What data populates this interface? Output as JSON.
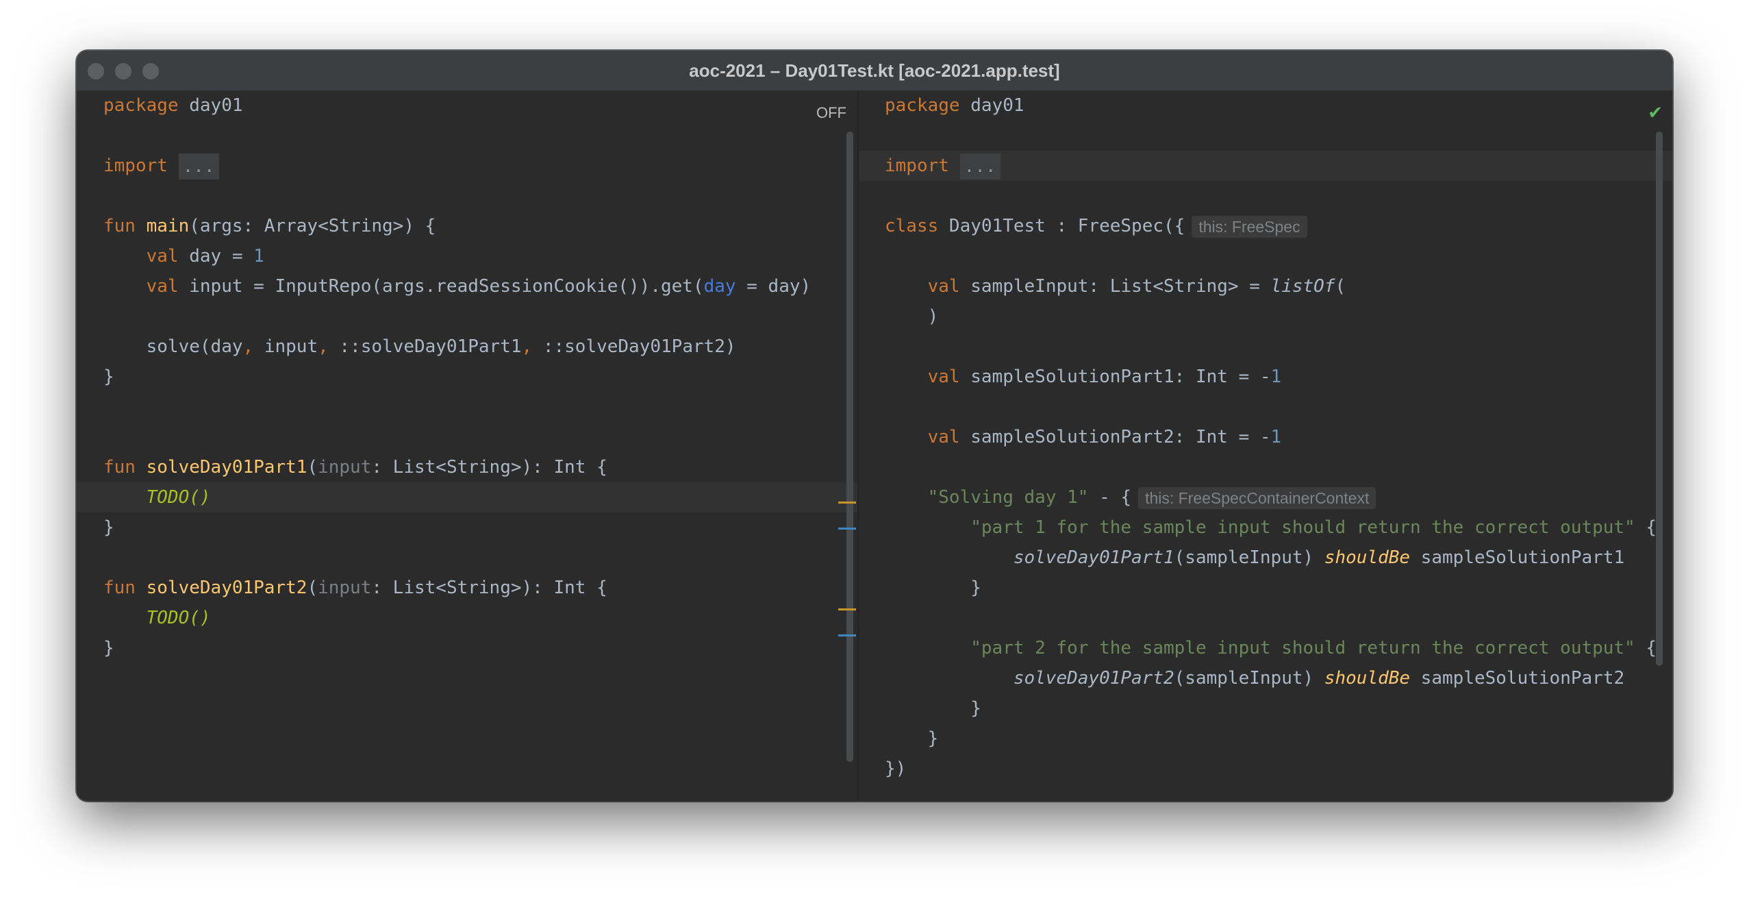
{
  "window": {
    "title": "aoc-2021 – Day01Test.kt [aoc-2021.app.test]"
  },
  "left_pane": {
    "status_label": "OFF",
    "lines": {
      "l1": [
        "package",
        " day01"
      ],
      "l3": [
        "import",
        "..."
      ],
      "l5": [
        "fun",
        "main",
        "(args: Array<String>) {"
      ],
      "l6": [
        "val",
        " day = ",
        "1"
      ],
      "l7": [
        "val",
        " input = InputRepo(args.readSessionCookie()).get(",
        "day",
        " = day)"
      ],
      "l9": [
        "solve(day",
        ",",
        " input",
        ",",
        " ::solveDay01Part1",
        ",",
        " ::solveDay01Part2)"
      ],
      "l10": [
        "}"
      ],
      "l13": [
        "fun",
        "solveDay01Part1",
        "(",
        "input",
        ": List<String>): Int {"
      ],
      "l14": [
        "TODO()"
      ],
      "l15": [
        "}"
      ],
      "l17": [
        "fun",
        "solveDay01Part2",
        "(",
        "input",
        ": List<String>): Int {"
      ],
      "l18": [
        "TODO()"
      ],
      "l19": [
        "}"
      ]
    }
  },
  "right_pane": {
    "status_icon": "checkmark-icon",
    "lines": {
      "l1": [
        "package",
        " day01"
      ],
      "l3": [
        "import",
        "..."
      ],
      "l5": [
        "class",
        " Day01Test : FreeSpec({",
        "this: FreeSpec"
      ],
      "l7": [
        "val",
        " sampleInput: List<String> = ",
        "listOf",
        "("
      ],
      "l8": [
        ")"
      ],
      "l10": [
        "val",
        " sampleSolutionPart1: Int = -",
        "1"
      ],
      "l12": [
        "val",
        " sampleSolutionPart2: Int = -",
        "1"
      ],
      "l14": [
        "\"Solving day 1\"",
        " - {",
        "this: FreeSpecContainerContext"
      ],
      "l15": [
        "\"part 1 for the sample input should return the correct output\"",
        " {"
      ],
      "l16": [
        "solveDay01Part1",
        "(sampleInput) ",
        "shouldBe",
        " sampleSolutionPart1"
      ],
      "l17": [
        "}"
      ],
      "l19": [
        "\"part 2 for the sample input should return the correct output\"",
        " {"
      ],
      "l20": [
        "solveDay01Part2",
        "(sampleInput) ",
        "shouldBe",
        " sampleSolutionPart2"
      ],
      "l21": [
        "}"
      ],
      "l22": [
        "}"
      ],
      "l23": [
        "})"
      ]
    }
  },
  "colors": {
    "keyword": "#cc7832",
    "function": "#ffc66d",
    "number": "#6897bb",
    "string": "#6a8759",
    "todo": "#a8c023",
    "text": "#a9b7c6",
    "background": "#2b2b2b"
  }
}
